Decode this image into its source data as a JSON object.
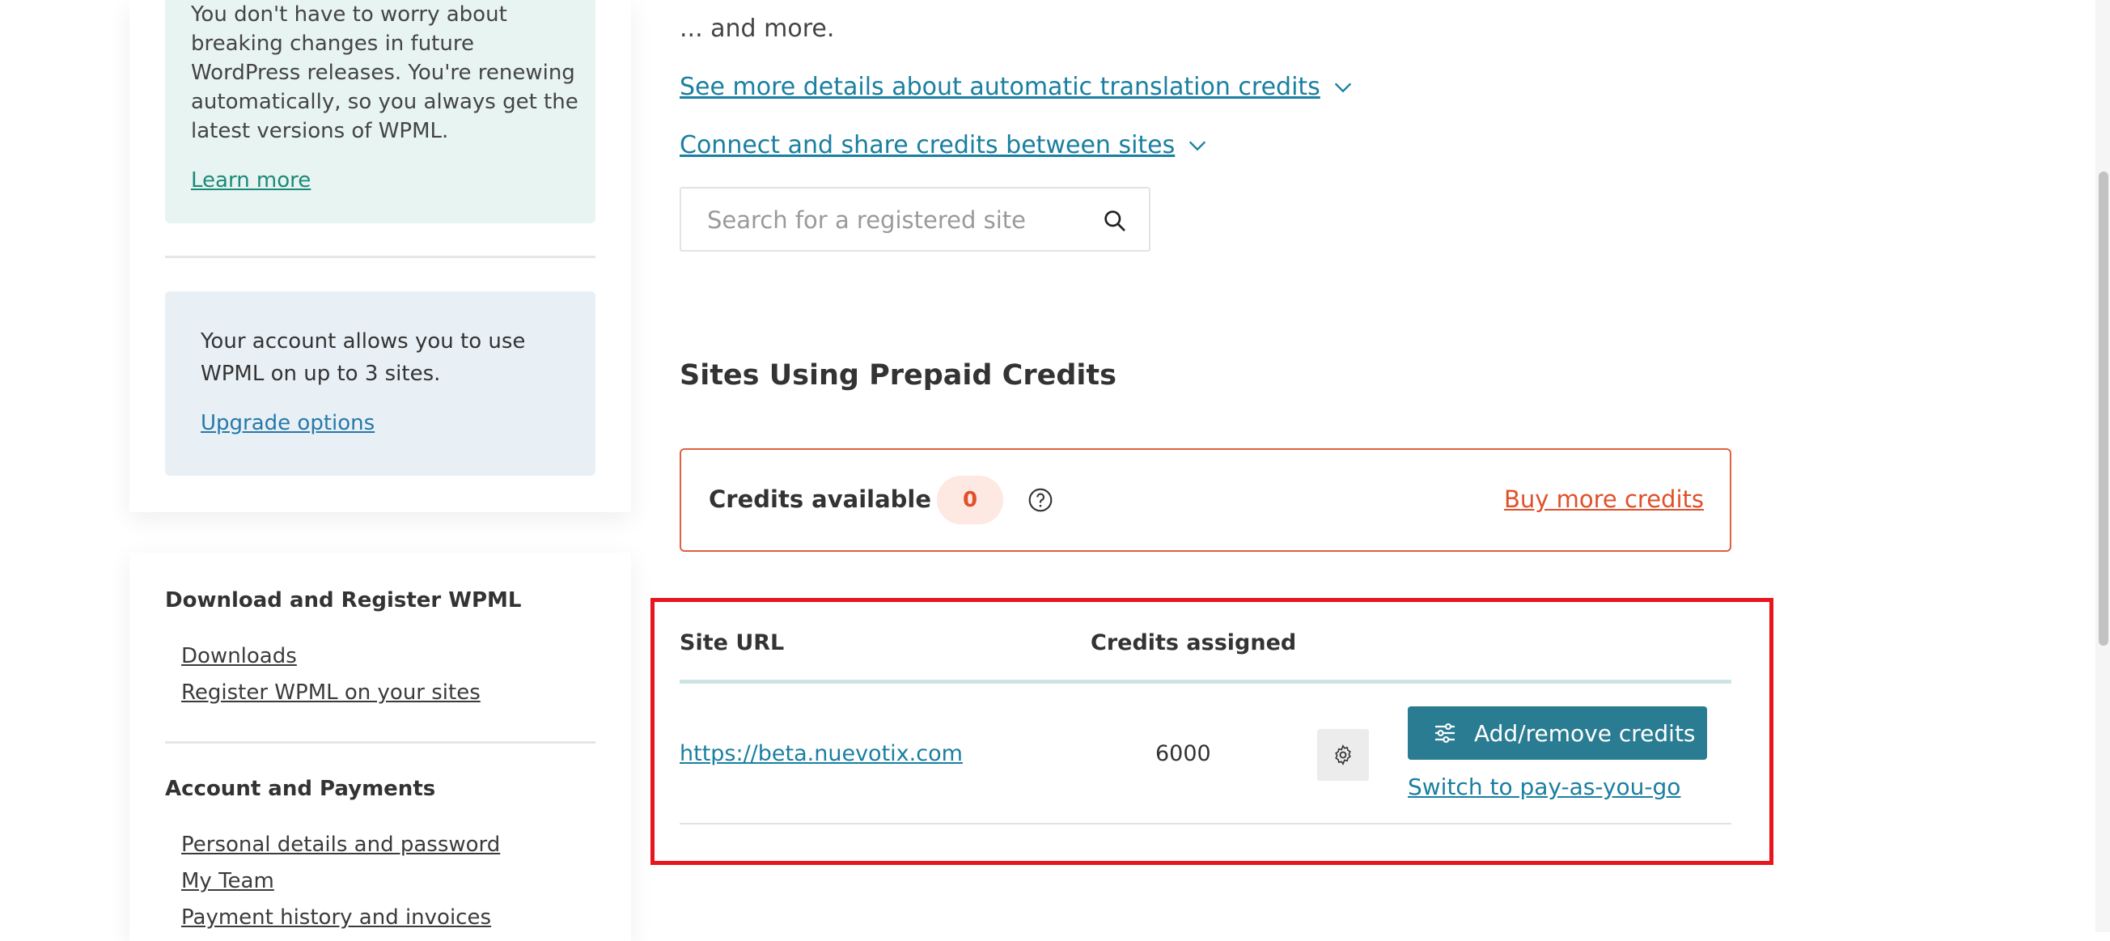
{
  "sidebar": {
    "renewal_notice": {
      "text": "You don't have to worry about breaking changes in future WordPress releases. You're renewing automatically, so you always get the latest versions of WPML.",
      "link": "Learn more"
    },
    "account_notice": {
      "text": "Your account allows you to use WPML on up to 3 sites.",
      "link": "Upgrade options"
    },
    "sections": [
      {
        "heading": "Download and Register WPML",
        "items": [
          "Downloads",
          "Register WPML on your sites"
        ]
      },
      {
        "heading": "Account and Payments",
        "items": [
          "Personal details and password",
          "My Team",
          "Payment history and invoices"
        ]
      }
    ]
  },
  "main": {
    "and_more": "... and more.",
    "details_toggle": "See more details about automatic translation credits",
    "connect_toggle": "Connect and share credits between sites",
    "search": {
      "placeholder": "Search for a registered site"
    },
    "section_title": "Sites Using Prepaid Credits",
    "credits_box": {
      "label": "Credits available",
      "value": "0",
      "buy_link": "Buy more credits"
    },
    "table": {
      "headers": [
        "Site URL",
        "Credits assigned"
      ],
      "rows": [
        {
          "url": "https://beta.nuevotix.com",
          "credits": "6000",
          "add_button": "Add/remove credits",
          "switch_link": "Switch to pay-as-you-go"
        }
      ]
    }
  },
  "colors": {
    "link_teal": "#1a7fa0",
    "accent_orange": "#e0502a",
    "button_teal": "#2a7c92",
    "highlight_red": "#e8141e",
    "notice_green_bg": "#e8f4f1",
    "notice_blue_bg": "#e8f0f6"
  }
}
